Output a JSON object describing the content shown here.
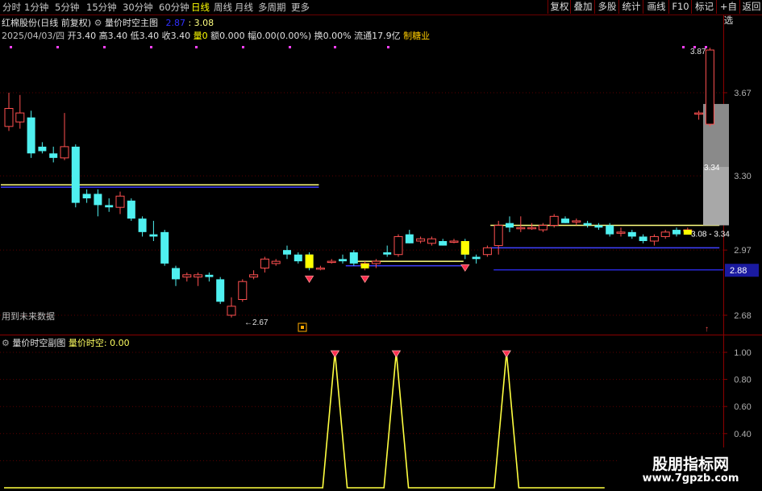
{
  "toolbar": {
    "periods": [
      "分时",
      "1分钟",
      "5分钟",
      "15分钟",
      "30分钟",
      "60分钟",
      "日线",
      "周线",
      "月线",
      "多周期",
      "更多"
    ],
    "active_index": 6,
    "buttons": [
      "复权",
      "叠加",
      "多股",
      "统计",
      "画线",
      "F10",
      "标记",
      "+自选",
      "返回"
    ]
  },
  "header": {
    "stock": "红棉股份(日线 前复权)",
    "indicator": "量价时空主图",
    "val_a": "2.87",
    "val_b": ": 3.08",
    "info_date": "2025/04/03/四",
    "info_open": "开3.40",
    "info_high": "高3.40",
    "info_low": "低3.40",
    "info_close": "收3.40",
    "info_vol": "量0",
    "info_amt": "额0.000",
    "info_chg": "幅0.00(0.00%)",
    "info_turn": "换0.00%",
    "info_float": "流通17.9亿",
    "info_sector": "制糖业"
  },
  "main_chart": {
    "future_note": "用到未来数据",
    "current_price": "2.88",
    "annotations": [
      "3.87",
      "3.34",
      "3.08 - 3.34",
      "2.67"
    ]
  },
  "sub_header": {
    "title": "量价时空副图",
    "value": "量价时空: 0.00"
  },
  "watermark": {
    "title": "股朋指标网",
    "url": "www.7gpzb.com"
  },
  "chart_data": [
    {
      "type": "candlestick",
      "ylim": [
        2.6,
        3.9
      ],
      "y_ticks": [
        "3.67",
        "3.30",
        "2.97",
        "2.68"
      ],
      "candles": [
        {
          "o": 3.52,
          "h": 3.67,
          "l": 3.5,
          "c": 3.6
        },
        {
          "o": 3.54,
          "h": 3.66,
          "l": 3.51,
          "c": 3.58
        },
        {
          "o": 3.56,
          "h": 3.59,
          "l": 3.38,
          "c": 3.4
        },
        {
          "o": 3.43,
          "h": 3.45,
          "l": 3.4,
          "c": 3.41
        },
        {
          "o": 3.4,
          "h": 3.43,
          "l": 3.36,
          "c": 3.38
        },
        {
          "o": 3.38,
          "h": 3.58,
          "l": 3.37,
          "c": 3.43
        },
        {
          "o": 3.43,
          "h": 3.44,
          "l": 3.16,
          "c": 3.18
        },
        {
          "o": 3.22,
          "h": 3.24,
          "l": 3.18,
          "c": 3.2
        },
        {
          "o": 3.22,
          "h": 3.24,
          "l": 3.12,
          "c": 3.17
        },
        {
          "o": 3.17,
          "h": 3.2,
          "l": 3.14,
          "c": 3.16
        },
        {
          "o": 3.16,
          "h": 3.23,
          "l": 3.13,
          "c": 3.21
        },
        {
          "o": 3.19,
          "h": 3.2,
          "l": 3.1,
          "c": 3.11
        },
        {
          "o": 3.11,
          "h": 3.12,
          "l": 3.03,
          "c": 3.05
        },
        {
          "o": 3.04,
          "h": 3.1,
          "l": 3.01,
          "c": 3.03
        },
        {
          "o": 3.05,
          "h": 3.06,
          "l": 2.9,
          "c": 2.91
        },
        {
          "o": 2.89,
          "h": 2.9,
          "l": 2.81,
          "c": 2.84
        },
        {
          "o": 2.85,
          "h": 2.87,
          "l": 2.83,
          "c": 2.86
        },
        {
          "o": 2.85,
          "h": 2.87,
          "l": 2.81,
          "c": 2.86
        },
        {
          "o": 2.86,
          "h": 2.87,
          "l": 2.83,
          "c": 2.85
        },
        {
          "o": 2.84,
          "h": 2.85,
          "l": 2.73,
          "c": 2.74
        },
        {
          "o": 2.68,
          "h": 2.76,
          "l": 2.67,
          "c": 2.72
        },
        {
          "o": 2.75,
          "h": 2.84,
          "l": 2.74,
          "c": 2.83
        },
        {
          "o": 2.85,
          "h": 2.88,
          "l": 2.84,
          "c": 2.86
        },
        {
          "o": 2.89,
          "h": 2.94,
          "l": 2.87,
          "c": 2.93
        },
        {
          "o": 2.91,
          "h": 2.93,
          "l": 2.9,
          "c": 2.92
        },
        {
          "o": 2.97,
          "h": 2.99,
          "l": 2.93,
          "c": 2.95
        },
        {
          "o": 2.95,
          "h": 2.96,
          "l": 2.91,
          "c": 2.92
        },
        {
          "o": 2.95,
          "h": 2.96,
          "l": 2.88,
          "c": 2.89
        },
        {
          "o": 2.89,
          "h": 2.9,
          "l": 2.88,
          "c": 2.89
        },
        {
          "o": 2.92,
          "h": 2.93,
          "l": 2.91,
          "c": 2.92
        },
        {
          "o": 2.93,
          "h": 2.95,
          "l": 2.91,
          "c": 2.92
        },
        {
          "o": 2.96,
          "h": 2.97,
          "l": 2.9,
          "c": 2.91
        },
        {
          "o": 2.9,
          "h": 2.92,
          "l": 2.88,
          "c": 2.91
        },
        {
          "o": 2.91,
          "h": 2.93,
          "l": 2.89,
          "c": 2.92
        },
        {
          "o": 2.96,
          "h": 2.99,
          "l": 2.94,
          "c": 2.95
        },
        {
          "o": 2.95,
          "h": 3.04,
          "l": 2.94,
          "c": 3.03
        },
        {
          "o": 3.04,
          "h": 3.06,
          "l": 3.0,
          "c": 3.0
        },
        {
          "o": 3.01,
          "h": 3.03,
          "l": 3.0,
          "c": 3.02
        },
        {
          "o": 3.0,
          "h": 3.03,
          "l": 2.99,
          "c": 3.02
        },
        {
          "o": 3.01,
          "h": 3.02,
          "l": 2.99,
          "c": 2.99
        },
        {
          "o": 3.01,
          "h": 3.02,
          "l": 3.0,
          "c": 3.01
        },
        {
          "o": 3.01,
          "h": 3.02,
          "l": 2.93,
          "c": 2.95
        },
        {
          "o": 2.94,
          "h": 2.95,
          "l": 2.91,
          "c": 2.93
        },
        {
          "o": 2.95,
          "h": 2.99,
          "l": 2.94,
          "c": 2.98
        },
        {
          "o": 2.99,
          "h": 3.1,
          "l": 2.95,
          "c": 3.08
        },
        {
          "o": 3.09,
          "h": 3.12,
          "l": 3.05,
          "c": 3.07
        },
        {
          "o": 3.07,
          "h": 3.12,
          "l": 3.05,
          "c": 3.07
        },
        {
          "o": 3.07,
          "h": 3.09,
          "l": 3.06,
          "c": 3.07
        },
        {
          "o": 3.06,
          "h": 3.09,
          "l": 3.05,
          "c": 3.08
        },
        {
          "o": 3.08,
          "h": 3.13,
          "l": 3.07,
          "c": 3.12
        },
        {
          "o": 3.11,
          "h": 3.12,
          "l": 3.09,
          "c": 3.09
        },
        {
          "o": 3.1,
          "h": 3.11,
          "l": 3.08,
          "c": 3.1
        },
        {
          "o": 3.09,
          "h": 3.1,
          "l": 3.07,
          "c": 3.08
        },
        {
          "o": 3.08,
          "h": 3.09,
          "l": 3.06,
          "c": 3.07
        },
        {
          "o": 3.08,
          "h": 3.09,
          "l": 3.03,
          "c": 3.04
        },
        {
          "o": 3.05,
          "h": 3.07,
          "l": 3.03,
          "c": 3.05
        },
        {
          "o": 3.05,
          "h": 3.06,
          "l": 3.02,
          "c": 3.03
        },
        {
          "o": 3.03,
          "h": 3.04,
          "l": 3.0,
          "c": 3.01
        },
        {
          "o": 3.01,
          "h": 3.04,
          "l": 2.99,
          "c": 3.03
        },
        {
          "o": 3.03,
          "h": 3.06,
          "l": 3.02,
          "c": 3.05
        },
        {
          "o": 3.06,
          "h": 3.07,
          "l": 3.03,
          "c": 3.04
        },
        {
          "o": 3.06,
          "h": 3.07,
          "l": 3.05,
          "c": 3.06
        },
        {
          "o": 3.58,
          "h": 3.59,
          "l": 3.55,
          "c": 3.58
        },
        {
          "o": 3.53,
          "h": 3.87,
          "l": 3.52,
          "c": 3.86
        }
      ],
      "gray_bars": [
        {
          "from": 3.34,
          "to": 3.62
        },
        {
          "from": 3.08,
          "to": 3.34
        }
      ],
      "yellow_boxes": [
        27,
        32,
        41,
        61
      ],
      "signal_markers": [
        27,
        32,
        41
      ],
      "lines": [
        {
          "color": "#ffff80",
          "y": 3.26,
          "from": 0,
          "to": 28
        },
        {
          "color": "#4040ff",
          "y": 3.25,
          "from": 0,
          "to": 28
        },
        {
          "color": "#ffff80",
          "y": 2.92,
          "from": 32,
          "to": 41
        },
        {
          "color": "#4040ff",
          "y": 2.9,
          "from": 31,
          "to": 41
        },
        {
          "color": "#ffff80",
          "y": 3.08,
          "from": 44,
          "to": 64
        },
        {
          "color": "#4040ff",
          "y": 2.98,
          "from": 44,
          "to": 64
        }
      ]
    },
    {
      "type": "line",
      "title": "量价时空",
      "ylim": [
        0,
        1.1
      ],
      "y_ticks": [
        "1.00",
        "0.80",
        "0.60",
        "0.40",
        "0.20"
      ],
      "series": [
        {
          "name": "量价时空",
          "values": [
            0,
            0,
            0,
            0,
            0,
            0,
            0,
            0,
            0,
            0,
            0,
            0,
            0,
            0,
            0,
            0,
            0,
            0,
            0,
            0,
            0,
            0,
            0,
            0,
            0,
            0,
            0,
            1,
            0,
            0,
            0,
            0,
            1,
            0,
            0,
            0,
            0,
            0,
            0,
            0,
            0,
            1,
            0,
            0,
            0,
            0,
            0,
            0,
            0,
            0
          ]
        }
      ]
    }
  ]
}
